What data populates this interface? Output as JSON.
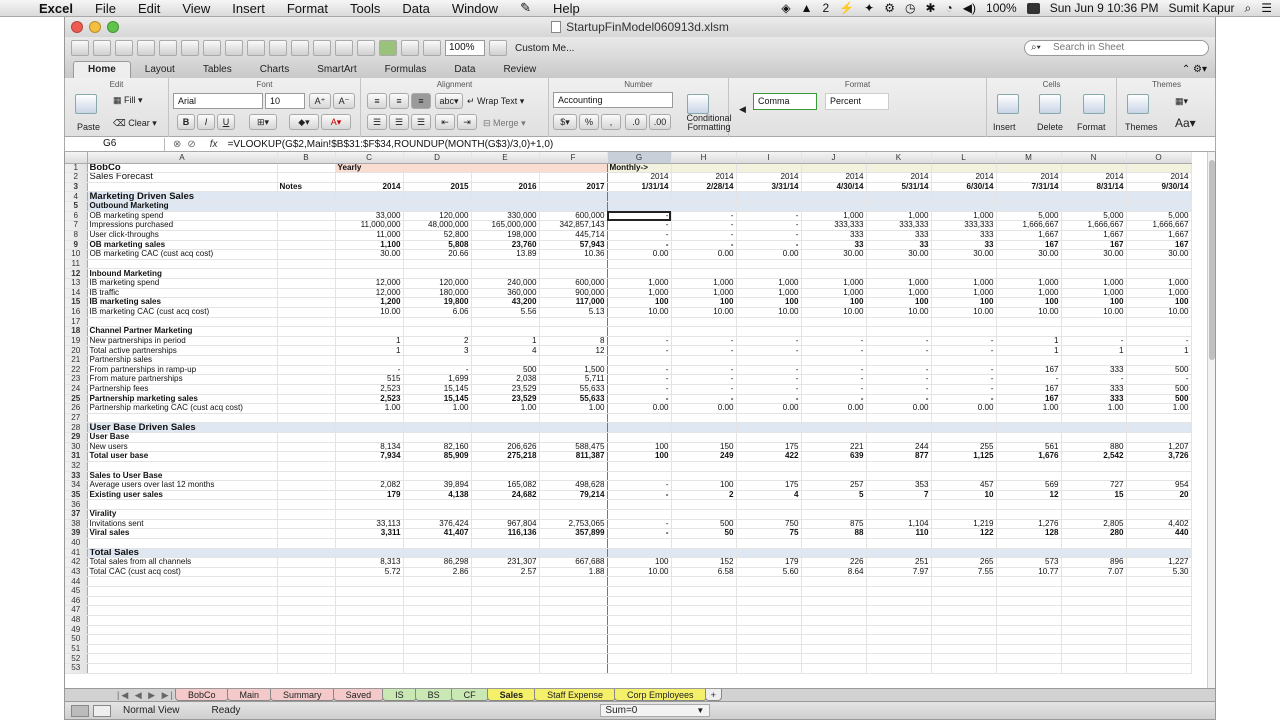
{
  "menubar": {
    "apple": "",
    "app": "Excel",
    "items": [
      "File",
      "Edit",
      "View",
      "Insert",
      "Format",
      "Tools",
      "Data",
      "Window",
      "Help"
    ],
    "badge": "2",
    "battery": "100%",
    "datetime": "Sun Jun 9  10:36 PM",
    "user": "Sumit Kapur"
  },
  "window": {
    "title": "StartupFinModel060913d.xlsm"
  },
  "toolbar": {
    "zoom": "100%",
    "custom": "Custom Me...",
    "search_placeholder": "Search in Sheet"
  },
  "ribbon_tabs": [
    "Home",
    "Layout",
    "Tables",
    "Charts",
    "SmartArt",
    "Formulas",
    "Data",
    "Review"
  ],
  "ribbon": {
    "groups": {
      "edit": "Edit",
      "font": "Font",
      "alignment": "Alignment",
      "number": "Number",
      "format": "Format",
      "cells": "Cells",
      "themes": "Themes"
    },
    "paste": "Paste",
    "fill": "Fill",
    "clear": "Clear",
    "font_name": "Arial",
    "font_size": "10",
    "wrap_text": "Wrap Text",
    "merge": "Merge",
    "number_format": "Accounting",
    "conditional_formatting": "Conditional Formatting",
    "style_comma": "Comma",
    "style_percent": "Percent",
    "insert": "Insert",
    "delete": "Delete",
    "format_btn": "Format",
    "themes_btn": "Themes"
  },
  "formula_bar": {
    "cell": "G6",
    "fx": "fx",
    "formula": "=VLOOKUP(G$2,Main!$B$31:$F$34,ROUNDUP(MONTH(G$3)/3,0)+1,0)"
  },
  "columns": [
    "",
    "A",
    "B",
    "C",
    "D",
    "E",
    "F",
    "G",
    "H",
    "I",
    "J",
    "K",
    "L",
    "M",
    "N",
    "O"
  ],
  "rows": [
    {
      "n": "1",
      "a": "BobCo",
      "b": "",
      "vals": [
        "Yearly",
        "",
        "",
        "",
        "Monthly->",
        "",
        "",
        "",
        "",
        "",
        "",
        "",
        ""
      ],
      "style": "section"
    },
    {
      "n": "2",
      "a": "Sales Forecast",
      "b": "",
      "vals": [
        "",
        "",
        "",
        "",
        "2014",
        "2014",
        "2014",
        "2014",
        "2014",
        "2014",
        "2014",
        "2014",
        "2014"
      ],
      "style": "bigtext"
    },
    {
      "n": "3",
      "a": "",
      "b": "Notes",
      "vals": [
        "2014",
        "2015",
        "2016",
        "2017",
        "1/31/14",
        "2/28/14",
        "3/31/14",
        "4/30/14",
        "5/31/14",
        "6/30/14",
        "7/31/14",
        "8/31/14",
        "9/30/14"
      ],
      "style": "bold"
    },
    {
      "n": "4",
      "a": "Marketing Driven Sales",
      "b": "",
      "vals": [
        "",
        "",
        "",
        "",
        "",
        "",
        "",
        "",
        "",
        "",
        "",
        "",
        ""
      ],
      "style": "section hdr"
    },
    {
      "n": "5",
      "a": "Outbound Marketing",
      "b": "",
      "vals": [
        "",
        "",
        "",
        "",
        "",
        "",
        "",
        "",
        "",
        "",
        "",
        "",
        ""
      ],
      "style": "bold hdr"
    },
    {
      "n": "6",
      "a": "  OB marketing spend",
      "b": "",
      "vals": [
        "33,000",
        "120,000",
        "330,000",
        "600,000",
        "-",
        "-",
        "-",
        "1,000",
        "1,000",
        "1,000",
        "5,000",
        "5,000",
        "5,000"
      ],
      "style": ""
    },
    {
      "n": "7",
      "a": "      Impressions purchased",
      "b": "",
      "vals": [
        "11,000,000",
        "48,000,000",
        "165,000,000",
        "342,857,143",
        "-",
        "-",
        "-",
        "333,333",
        "333,333",
        "333,333",
        "1,666,667",
        "1,666,667",
        "1,666,667"
      ],
      "style": ""
    },
    {
      "n": "8",
      "a": "      User click-throughs",
      "b": "",
      "vals": [
        "11,000",
        "52,800",
        "198,000",
        "445,714",
        "-",
        "-",
        "-",
        "333",
        "333",
        "333",
        "1,667",
        "1,667",
        "1,667"
      ],
      "style": ""
    },
    {
      "n": "9",
      "a": "  OB marketing sales",
      "b": "",
      "vals": [
        "1,100",
        "5,808",
        "23,760",
        "57,943",
        "-",
        "-",
        "-",
        "33",
        "33",
        "33",
        "167",
        "167",
        "167"
      ],
      "style": "bold"
    },
    {
      "n": "10",
      "a": "OB marketing CAC (cust acq cost)",
      "b": "",
      "vals": [
        "30.00",
        "20.66",
        "13.89",
        "10.36",
        "0.00",
        "0.00",
        "0.00",
        "30.00",
        "30.00",
        "30.00",
        "30.00",
        "30.00",
        "30.00"
      ],
      "style": ""
    },
    {
      "n": "11",
      "a": "",
      "b": "",
      "vals": [
        "",
        "",
        "",
        "",
        "",
        "",
        "",
        "",
        "",
        "",
        "",
        "",
        ""
      ],
      "style": ""
    },
    {
      "n": "12",
      "a": "Inbound Marketing",
      "b": "",
      "vals": [
        "",
        "",
        "",
        "",
        "",
        "",
        "",
        "",
        "",
        "",
        "",
        "",
        ""
      ],
      "style": "bold"
    },
    {
      "n": "13",
      "a": "  IB marketing spend",
      "b": "",
      "vals": [
        "12,000",
        "120,000",
        "240,000",
        "600,000",
        "1,000",
        "1,000",
        "1,000",
        "1,000",
        "1,000",
        "1,000",
        "1,000",
        "1,000",
        "1,000"
      ],
      "style": ""
    },
    {
      "n": "14",
      "a": "      IB traffic",
      "b": "",
      "vals": [
        "12,000",
        "180,000",
        "360,000",
        "900,000",
        "1,000",
        "1,000",
        "1,000",
        "1,000",
        "1,000",
        "1,000",
        "1,000",
        "1,000",
        "1,000"
      ],
      "style": ""
    },
    {
      "n": "15",
      "a": "  IB marketing sales",
      "b": "",
      "vals": [
        "1,200",
        "19,800",
        "43,200",
        "117,000",
        "100",
        "100",
        "100",
        "100",
        "100",
        "100",
        "100",
        "100",
        "100"
      ],
      "style": "bold"
    },
    {
      "n": "16",
      "a": "IB marketing CAC (cust acq cost)",
      "b": "",
      "vals": [
        "10.00",
        "6.06",
        "5.56",
        "5.13",
        "10.00",
        "10.00",
        "10.00",
        "10.00",
        "10.00",
        "10.00",
        "10.00",
        "10.00",
        "10.00"
      ],
      "style": ""
    },
    {
      "n": "17",
      "a": "",
      "b": "",
      "vals": [
        "",
        "",
        "",
        "",
        "",
        "",
        "",
        "",
        "",
        "",
        "",
        "",
        ""
      ],
      "style": ""
    },
    {
      "n": "18",
      "a": "Channel Partner Marketing",
      "b": "",
      "vals": [
        "",
        "",
        "",
        "",
        "",
        "",
        "",
        "",
        "",
        "",
        "",
        "",
        ""
      ],
      "style": "bold"
    },
    {
      "n": "19",
      "a": "  New partnerships in period",
      "b": "",
      "vals": [
        "1",
        "2",
        "1",
        "8",
        "-",
        "-",
        "-",
        "-",
        "-",
        "-",
        "1",
        "-",
        "-"
      ],
      "style": ""
    },
    {
      "n": "20",
      "a": "  Total active partnerships",
      "b": "",
      "vals": [
        "1",
        "3",
        "4",
        "12",
        "-",
        "-",
        "-",
        "-",
        "-",
        "-",
        "1",
        "1",
        "1"
      ],
      "style": ""
    },
    {
      "n": "21",
      "a": "  Partnership sales",
      "b": "",
      "vals": [
        "",
        "",
        "",
        "",
        "",
        "",
        "",
        "",
        "",
        "",
        "",
        "",
        ""
      ],
      "style": ""
    },
    {
      "n": "22",
      "a": "      From partnerships in ramp-up",
      "b": "",
      "vals": [
        "-",
        "-",
        "500",
        "1,500",
        "-",
        "-",
        "-",
        "-",
        "-",
        "-",
        "167",
        "333",
        "500"
      ],
      "style": ""
    },
    {
      "n": "23",
      "a": "      From mature partnerships",
      "b": "",
      "vals": [
        "515",
        "1,699",
        "2,038",
        "5,711",
        "-",
        "-",
        "-",
        "-",
        "-",
        "-",
        "-",
        "-",
        "-"
      ],
      "style": ""
    },
    {
      "n": "24",
      "a": "  Partnership fees",
      "b": "",
      "vals": [
        "2,523",
        "15,145",
        "23,529",
        "55,633",
        "-",
        "-",
        "-",
        "-",
        "-",
        "-",
        "167",
        "333",
        "500"
      ],
      "style": ""
    },
    {
      "n": "25",
      "a": "  Partnership marketing sales",
      "b": "",
      "vals": [
        "2,523",
        "15,145",
        "23,529",
        "55,633",
        "-",
        "-",
        "-",
        "-",
        "-",
        "-",
        "167",
        "333",
        "500"
      ],
      "style": "bold"
    },
    {
      "n": "26",
      "a": "Partnership marketing CAC (cust acq cost)",
      "b": "",
      "vals": [
        "1.00",
        "1.00",
        "1.00",
        "1.00",
        "0.00",
        "0.00",
        "0.00",
        "0.00",
        "0.00",
        "0.00",
        "1.00",
        "1.00",
        "1.00"
      ],
      "style": ""
    },
    {
      "n": "27",
      "a": "",
      "b": "",
      "vals": [
        "",
        "",
        "",
        "",
        "",
        "",
        "",
        "",
        "",
        "",
        "",
        "",
        ""
      ],
      "style": ""
    },
    {
      "n": "28",
      "a": "User Base Driven Sales",
      "b": "",
      "vals": [
        "",
        "",
        "",
        "",
        "",
        "",
        "",
        "",
        "",
        "",
        "",
        "",
        ""
      ],
      "style": "section hdr"
    },
    {
      "n": "29",
      "a": "User Base",
      "b": "",
      "vals": [
        "",
        "",
        "",
        "",
        "",
        "",
        "",
        "",
        "",
        "",
        "",
        "",
        ""
      ],
      "style": "bold"
    },
    {
      "n": "30",
      "a": "  New users",
      "b": "",
      "vals": [
        "8,134",
        "82,160",
        "206,626",
        "588,475",
        "100",
        "150",
        "175",
        "221",
        "244",
        "255",
        "561",
        "880",
        "1,207"
      ],
      "style": ""
    },
    {
      "n": "31",
      "a": "  Total user base",
      "b": "",
      "vals": [
        "7,934",
        "85,909",
        "275,218",
        "811,387",
        "100",
        "249",
        "422",
        "639",
        "877",
        "1,125",
        "1,676",
        "2,542",
        "3,726"
      ],
      "style": "bold"
    },
    {
      "n": "32",
      "a": "",
      "b": "",
      "vals": [
        "",
        "",
        "",
        "",
        "",
        "",
        "",
        "",
        "",
        "",
        "",
        "",
        ""
      ],
      "style": ""
    },
    {
      "n": "33",
      "a": "Sales to User Base",
      "b": "",
      "vals": [
        "",
        "",
        "",
        "",
        "",
        "",
        "",
        "",
        "",
        "",
        "",
        "",
        ""
      ],
      "style": "bold"
    },
    {
      "n": "34",
      "a": "Average users over last 12 months",
      "b": "",
      "vals": [
        "2,082",
        "39,894",
        "165,082",
        "498,628",
        "-",
        "100",
        "175",
        "257",
        "353",
        "457",
        "569",
        "727",
        "954"
      ],
      "style": ""
    },
    {
      "n": "35",
      "a": "  Existing user sales",
      "b": "",
      "vals": [
        "179",
        "4,138",
        "24,682",
        "79,214",
        "-",
        "2",
        "4",
        "5",
        "7",
        "10",
        "12",
        "15",
        "20"
      ],
      "style": "bold"
    },
    {
      "n": "36",
      "a": "",
      "b": "",
      "vals": [
        "",
        "",
        "",
        "",
        "",
        "",
        "",
        "",
        "",
        "",
        "",
        "",
        ""
      ],
      "style": ""
    },
    {
      "n": "37",
      "a": "Virality",
      "b": "",
      "vals": [
        "",
        "",
        "",
        "",
        "",
        "",
        "",
        "",
        "",
        "",
        "",
        "",
        ""
      ],
      "style": "bold"
    },
    {
      "n": "38",
      "a": "  Invitations sent",
      "b": "",
      "vals": [
        "33,113",
        "376,424",
        "967,804",
        "2,753,065",
        "-",
        "500",
        "750",
        "875",
        "1,104",
        "1,219",
        "1,276",
        "2,805",
        "4,402"
      ],
      "style": ""
    },
    {
      "n": "39",
      "a": "  Viral sales",
      "b": "",
      "vals": [
        "3,311",
        "41,407",
        "116,136",
        "357,899",
        "-",
        "50",
        "75",
        "88",
        "110",
        "122",
        "128",
        "280",
        "440"
      ],
      "style": "bold"
    },
    {
      "n": "40",
      "a": "",
      "b": "",
      "vals": [
        "",
        "",
        "",
        "",
        "",
        "",
        "",
        "",
        "",
        "",
        "",
        "",
        ""
      ],
      "style": ""
    },
    {
      "n": "41",
      "a": "Total Sales",
      "b": "",
      "vals": [
        "",
        "",
        "",
        "",
        "",
        "",
        "",
        "",
        "",
        "",
        "",
        "",
        ""
      ],
      "style": "section hdr"
    },
    {
      "n": "42",
      "a": "Total sales from all channels",
      "b": "",
      "vals": [
        "8,313",
        "86,298",
        "231,307",
        "667,688",
        "100",
        "152",
        "179",
        "226",
        "251",
        "265",
        "573",
        "896",
        "1,227"
      ],
      "style": ""
    },
    {
      "n": "43",
      "a": "Total CAC (cust acq cost)",
      "b": "",
      "vals": [
        "5.72",
        "2.86",
        "2.57",
        "1.88",
        "10.00",
        "6.58",
        "5.60",
        "8.64",
        "7.97",
        "7.55",
        "10.77",
        "7.07",
        "5.30"
      ],
      "style": ""
    },
    {
      "n": "44",
      "a": "",
      "b": "",
      "vals": [
        "",
        "",
        "",
        "",
        "",
        "",
        "",
        "",
        "",
        "",
        "",
        "",
        ""
      ],
      "style": ""
    },
    {
      "n": "45",
      "a": "",
      "b": "",
      "vals": [
        "",
        "",
        "",
        "",
        "",
        "",
        "",
        "",
        "",
        "",
        "",
        "",
        ""
      ],
      "style": ""
    },
    {
      "n": "46",
      "a": "",
      "b": "",
      "vals": [
        "",
        "",
        "",
        "",
        "",
        "",
        "",
        "",
        "",
        "",
        "",
        "",
        ""
      ],
      "style": ""
    },
    {
      "n": "47",
      "a": "",
      "b": "",
      "vals": [
        "",
        "",
        "",
        "",
        "",
        "",
        "",
        "",
        "",
        "",
        "",
        "",
        ""
      ],
      "style": ""
    },
    {
      "n": "48",
      "a": "",
      "b": "",
      "vals": [
        "",
        "",
        "",
        "",
        "",
        "",
        "",
        "",
        "",
        "",
        "",
        "",
        ""
      ],
      "style": ""
    },
    {
      "n": "49",
      "a": "",
      "b": "",
      "vals": [
        "",
        "",
        "",
        "",
        "",
        "",
        "",
        "",
        "",
        "",
        "",
        "",
        ""
      ],
      "style": ""
    },
    {
      "n": "50",
      "a": "",
      "b": "",
      "vals": [
        "",
        "",
        "",
        "",
        "",
        "",
        "",
        "",
        "",
        "",
        "",
        "",
        ""
      ],
      "style": ""
    },
    {
      "n": "51",
      "a": "",
      "b": "",
      "vals": [
        "",
        "",
        "",
        "",
        "",
        "",
        "",
        "",
        "",
        "",
        "",
        "",
        ""
      ],
      "style": ""
    },
    {
      "n": "52",
      "a": "",
      "b": "",
      "vals": [
        "",
        "",
        "",
        "",
        "",
        "",
        "",
        "",
        "",
        "",
        "",
        "",
        ""
      ],
      "style": ""
    },
    {
      "n": "53",
      "a": "",
      "b": "",
      "vals": [
        "",
        "",
        "",
        "",
        "",
        "",
        "",
        "",
        "",
        "",
        "",
        "",
        ""
      ],
      "style": ""
    }
  ],
  "sheet_tabs": {
    "nav": "|◀ ◀ ▶ ▶|",
    "tabs": [
      {
        "label": "BobCo",
        "color": "#f4c9c9"
      },
      {
        "label": "Main",
        "color": "#f4c9c9"
      },
      {
        "label": "Summary",
        "color": "#f4c9c9"
      },
      {
        "label": "Saved",
        "color": "#f4c9c9"
      },
      {
        "label": "IS",
        "color": "#c9e8b4"
      },
      {
        "label": "BS",
        "color": "#c9e8b4"
      },
      {
        "label": "CF",
        "color": "#c9e8b4"
      },
      {
        "label": "Sales",
        "color": "#f5f06a"
      },
      {
        "label": "Staff Expense",
        "color": "#f5f06a"
      },
      {
        "label": "Corp Employees",
        "color": "#f5f06a"
      }
    ],
    "plus": "+"
  },
  "statusbar": {
    "view": "Normal View",
    "ready": "Ready",
    "sum": "Sum=0"
  }
}
